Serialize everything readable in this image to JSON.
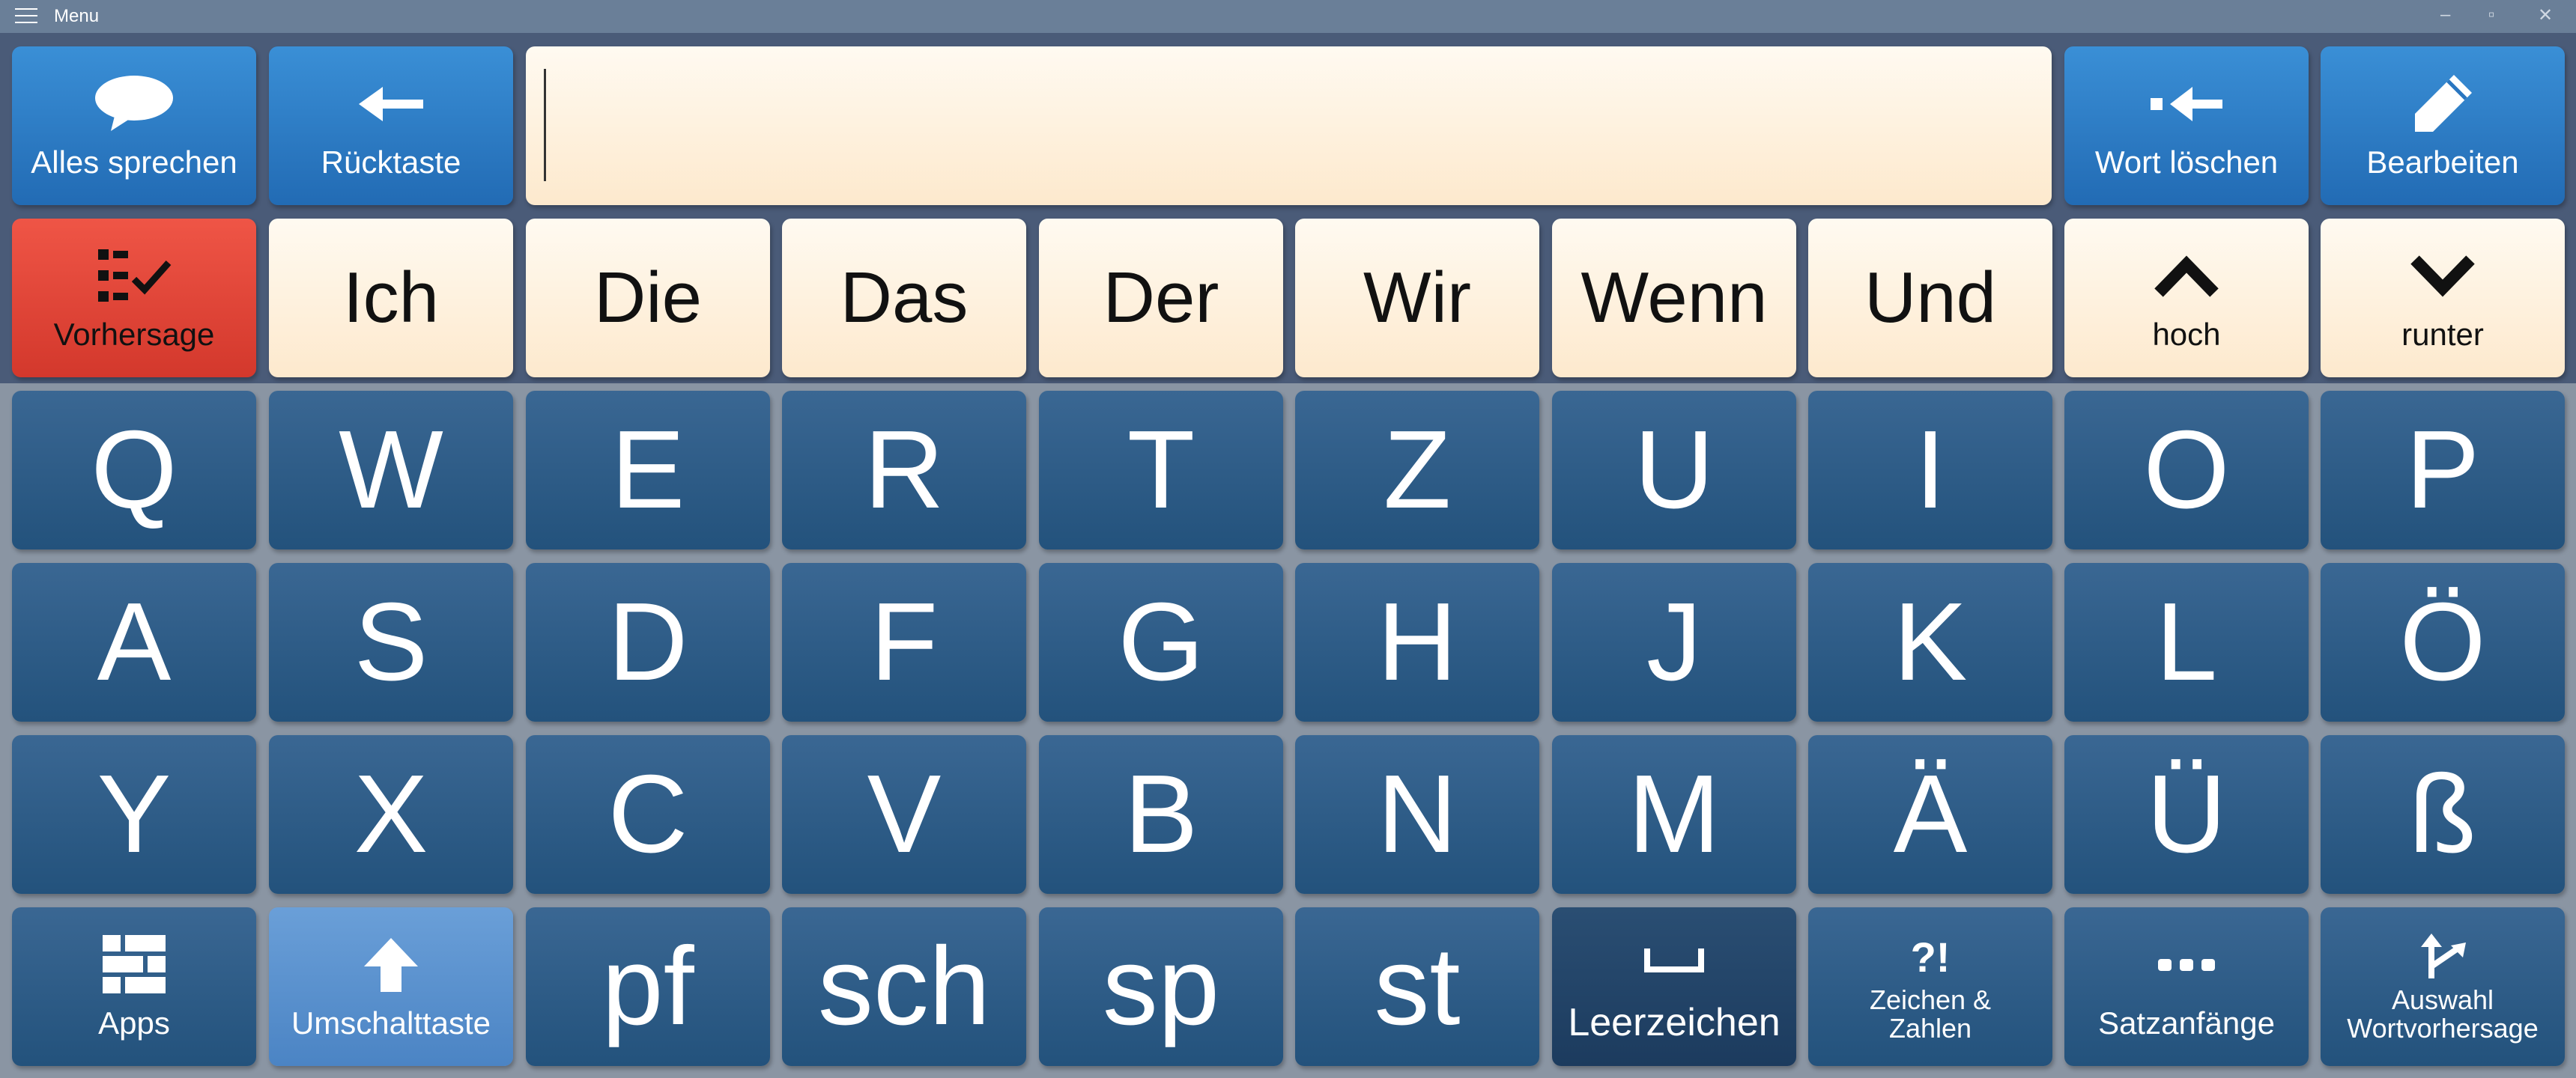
{
  "titlebar": {
    "title": "Menu",
    "minimize": "–",
    "maximize": "▫",
    "close": "✕"
  },
  "toolbar": {
    "speak_all": "Alles sprechen",
    "backspace": "Rücktaste",
    "delete_word": "Wort löschen",
    "edit": "Bearbeiten"
  },
  "text_field": {
    "value": ""
  },
  "prediction": {
    "toggle_label": "Vorhersage",
    "words": [
      "Ich",
      "Die",
      "Das",
      "Der",
      "Wir",
      "Wenn",
      "Und"
    ],
    "up_label": "hoch",
    "down_label": "runter"
  },
  "keyboard": {
    "row1": [
      "Q",
      "W",
      "E",
      "R",
      "T",
      "Z",
      "U",
      "I",
      "O",
      "P"
    ],
    "row2": [
      "A",
      "S",
      "D",
      "F",
      "G",
      "H",
      "J",
      "K",
      "L",
      "Ö"
    ],
    "row3": [
      "Y",
      "X",
      "C",
      "V",
      "B",
      "N",
      "M",
      "Ä",
      "Ü",
      "ß"
    ],
    "row4": {
      "apps": "Apps",
      "shift": "Umschalttaste",
      "clusters": [
        "pf",
        "sch",
        "sp",
        "st"
      ],
      "space": "Leerzeichen",
      "symbols_line1": "Zeichen &",
      "symbols_line2": "Zahlen",
      "symbols_icon": "?!",
      "sentence_starters": "Satzanfänge",
      "word_pred_line1": "Auswahl",
      "word_pred_line2": "Wortvorhersage"
    }
  },
  "colors": {
    "blue_key": "#2f7fc9",
    "red_key": "#e4473a",
    "cream_key": "#fdf1de",
    "letter_key": "#2e5d88",
    "shift_key": "#5b92cf",
    "space_key": "#23456a",
    "top_band": "#4a5b78",
    "keyboard_bg": "#8a95a3"
  }
}
